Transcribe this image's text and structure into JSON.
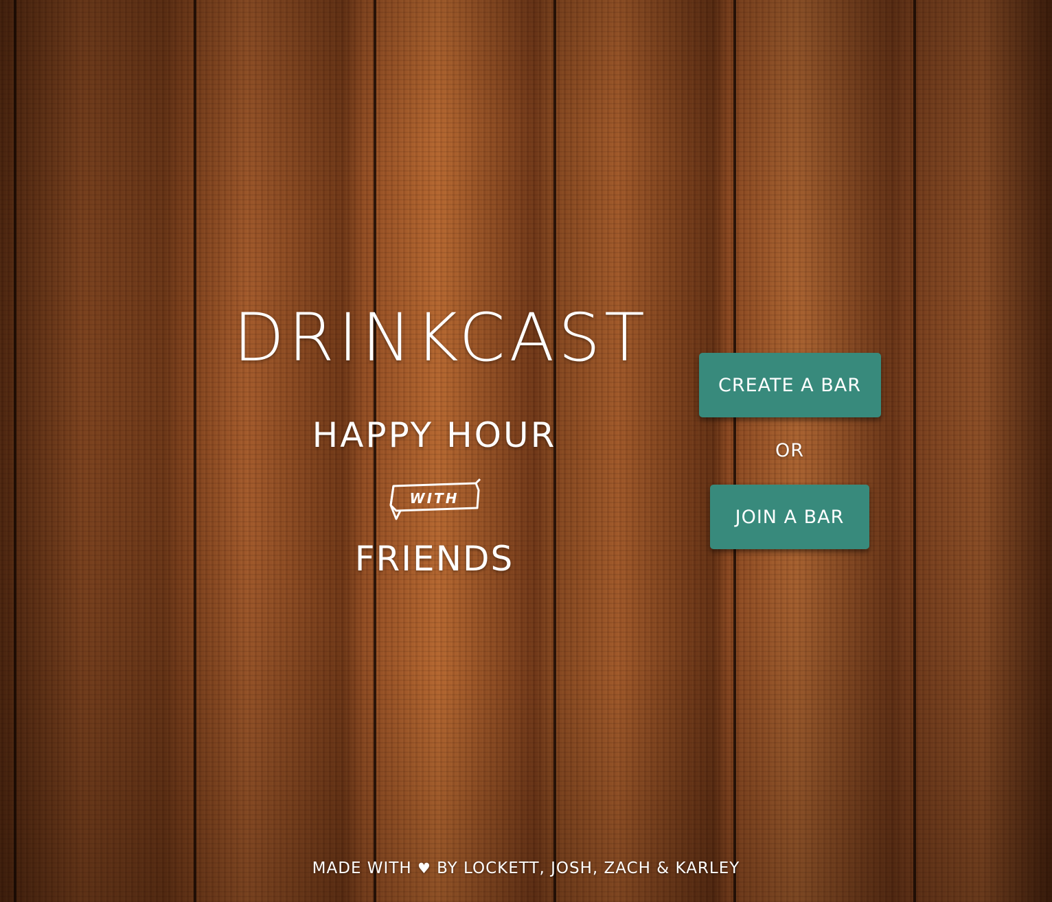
{
  "hero": {
    "title": "DRINKCAST",
    "subtitle": "HAPPY HOUR",
    "connector": "WITH",
    "tagline_end": "FRIENDS"
  },
  "actions": {
    "create_label": "CREATE A BAR",
    "separator": "OR",
    "join_label": "JOIN A BAR",
    "button_color": "#388a7c"
  },
  "footer": {
    "prefix": "MADE WITH",
    "heart_glyph": "♥",
    "suffix": "BY LOCKETT, JOSH, ZACH & KARLEY",
    "heart_icon": "heart-icon"
  },
  "background": {
    "texture": "wood-planks"
  }
}
